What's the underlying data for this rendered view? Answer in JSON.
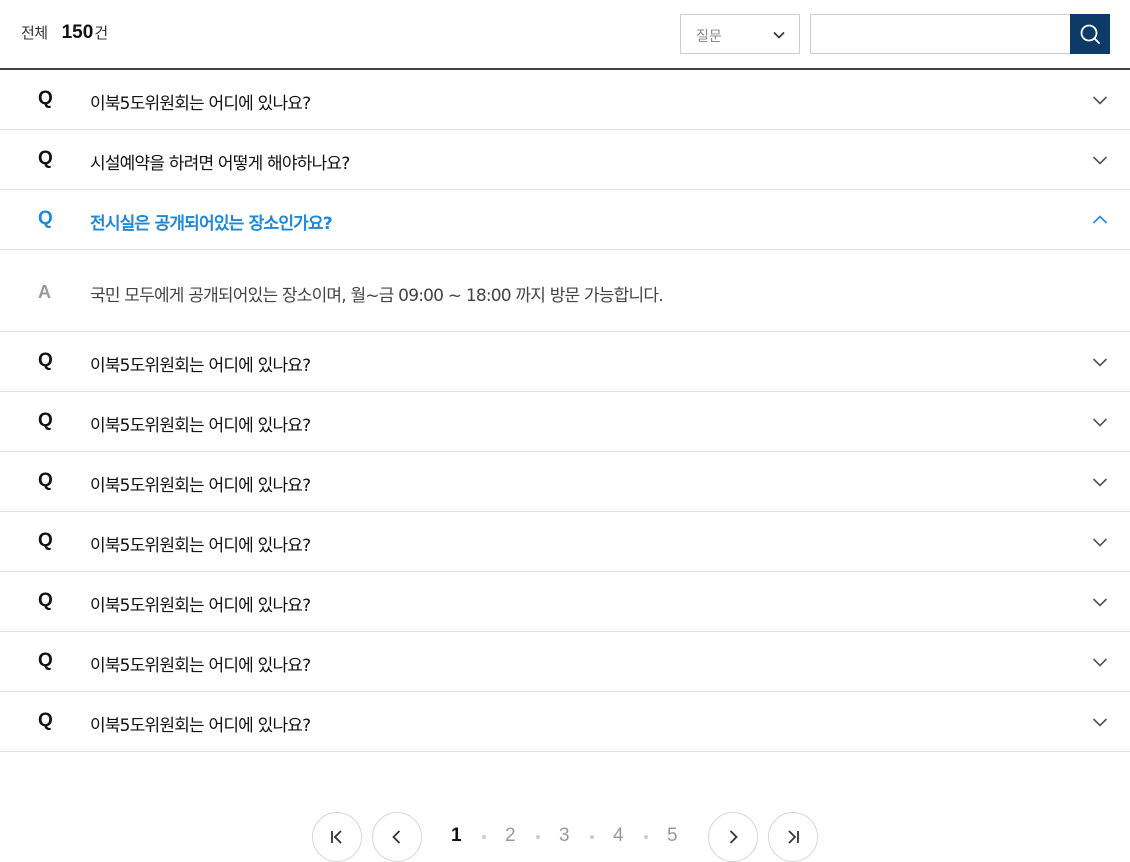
{
  "toolbar": {
    "total_label": "전체",
    "total_count": "150",
    "total_unit": "건",
    "filter": {
      "selected": "질문"
    },
    "search": {
      "value": ""
    }
  },
  "faq": {
    "question_mark": "Q",
    "answer_mark": "A",
    "items": [
      {
        "question": "이북5도위원회는 어디에 있나요?",
        "open": false
      },
      {
        "question": "시설예약을 하려면 어떻게 해야하나요?",
        "open": false
      },
      {
        "question": "전시실은 공개되어있는 장소인가요?",
        "open": true,
        "answer": "국민 모두에게 공개되어있는 장소이며, 월~금 09:00 ~ 18:00 까지 방문 가능합니다."
      },
      {
        "question": "이북5도위원회는 어디에 있나요?",
        "open": false
      },
      {
        "question": "이북5도위원회는 어디에 있나요?",
        "open": false
      },
      {
        "question": "이북5도위원회는 어디에 있나요?",
        "open": false
      },
      {
        "question": "이북5도위원회는 어디에 있나요?",
        "open": false
      },
      {
        "question": "이북5도위원회는 어디에 있나요?",
        "open": false
      },
      {
        "question": "이북5도위원회는 어디에 있나요?",
        "open": false
      },
      {
        "question": "이북5도위원회는 어디에 있나요?",
        "open": false
      }
    ]
  },
  "pagination": {
    "pages": [
      "1",
      "2",
      "3",
      "4",
      "5"
    ],
    "current": "1"
  },
  "colors": {
    "accent": "#1e88d9",
    "search_button": "#0d3a66"
  },
  "icons": {
    "select": "chevron-down-icon",
    "search": "search-icon",
    "collapsed": "chevron-down-icon",
    "expanded": "chevron-up-icon",
    "first": "first-page-icon",
    "prev": "chevron-left-icon",
    "next": "chevron-right-icon",
    "last": "last-page-icon"
  }
}
